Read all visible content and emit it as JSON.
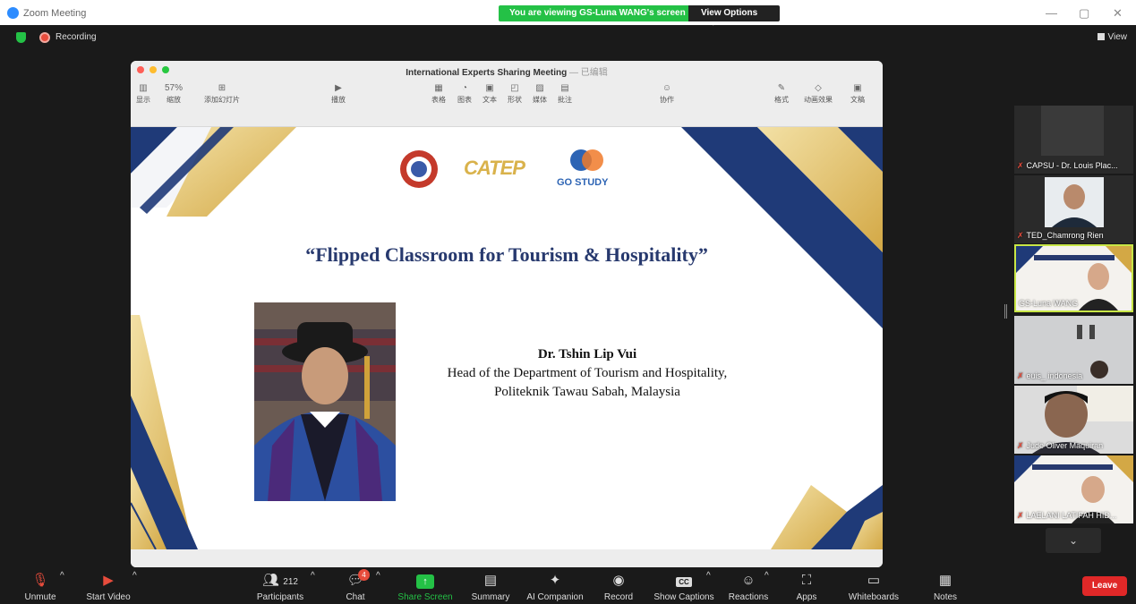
{
  "window": {
    "title": "Zoom Meeting",
    "share_banner": "You are viewing GS-Luna WANG's screen",
    "view_options": "View Options"
  },
  "status": {
    "recording": "Recording",
    "view": "View"
  },
  "keynote": {
    "title": "International Experts Sharing Meeting",
    "subtitle": "— 已编辑",
    "zoom": "57%",
    "tools": [
      {
        "label": "显示"
      },
      {
        "label": "缩放"
      },
      {
        "label": "添加幻灯片"
      },
      {
        "label": "播放"
      },
      {
        "label": "表格"
      },
      {
        "label": "图表"
      },
      {
        "label": "文本"
      },
      {
        "label": "形状"
      },
      {
        "label": "媒体"
      },
      {
        "label": "批注"
      },
      {
        "label": "协作"
      },
      {
        "label": "格式"
      },
      {
        "label": "动画效果"
      },
      {
        "label": "文稿"
      }
    ]
  },
  "slide": {
    "logo_catep": "CATEP",
    "logo_gostudy": "GO STUDY",
    "title": "“Flipped Classroom for Tourism & Hospitality”",
    "speaker_name": "Dr. Tshin Lip Vui",
    "speaker_role": "Head of the Department of Tourism and Hospitality,",
    "speaker_org": "Politeknik Tawau Sabah, Malaysia"
  },
  "participants_gallery": [
    {
      "name": "CAPSU - Dr. Louis Plac..."
    },
    {
      "name": "TED_Chamrong Rien"
    },
    {
      "name": "GS-Luna WANG"
    },
    {
      "name": "euis_ indonesia"
    },
    {
      "name": "Jude Oliver Maquiran"
    },
    {
      "name": "LAELANI LATIFAH HID..."
    }
  ],
  "toolbar": {
    "unmute": "Unmute",
    "start_video": "Start Video",
    "participants": "Participants",
    "participants_count": "212",
    "chat": "Chat",
    "chat_badge": "4",
    "share_screen": "Share Screen",
    "summary": "Summary",
    "ai_companion": "AI Companion",
    "record": "Record",
    "show_captions": "Show Captions",
    "captions_icon": "CC",
    "reactions": "Reactions",
    "apps": "Apps",
    "whiteboards": "Whiteboards",
    "notes": "Notes",
    "leave": "Leave"
  },
  "colors": {
    "accent_green": "#24c146",
    "leave_red": "#e02828",
    "slide_navy": "#27396e",
    "slide_gold": "#d9b24b",
    "active_speaker": "#c8e646"
  }
}
